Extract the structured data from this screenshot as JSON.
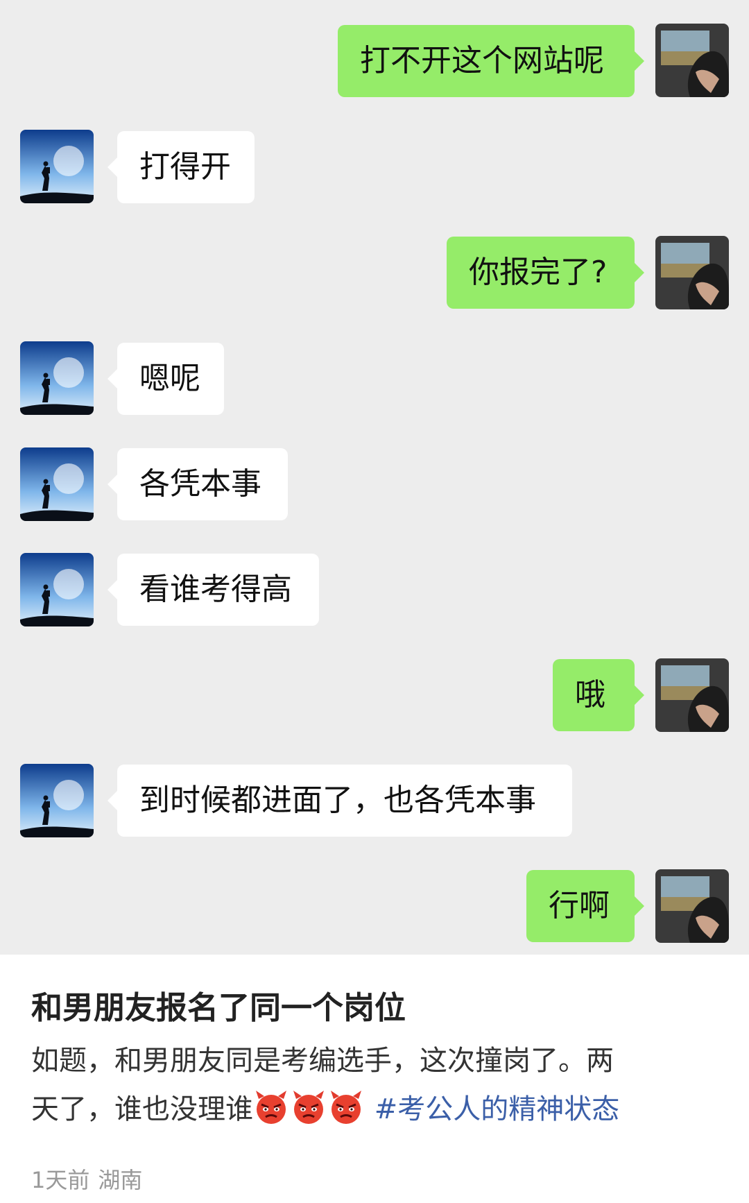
{
  "chat": {
    "messages": [
      {
        "side": "out",
        "text": "打不开这个网站呢"
      },
      {
        "side": "in",
        "text": "打得开"
      },
      {
        "side": "out",
        "text": "你报完了?"
      },
      {
        "side": "in",
        "text": "嗯呢"
      },
      {
        "side": "in",
        "text": "各凭本事"
      },
      {
        "side": "in",
        "text": "看谁考得高"
      },
      {
        "side": "out",
        "text": "哦"
      },
      {
        "side": "in",
        "text": "到时候都进面了，也各凭本事"
      },
      {
        "side": "out",
        "text": "行啊"
      }
    ],
    "colors": {
      "background": "#ededed",
      "incoming_bubble": "#ffffff",
      "outgoing_bubble": "#95ec69"
    },
    "avatars": {
      "incoming": "hiker-silhouette-avatar",
      "outgoing": "car-window-photo-avatar"
    }
  },
  "post": {
    "title": "和男朋友报名了同一个岗位",
    "body_line1": "如题，和男朋友同是考编选手，这次撞岗了。两",
    "body_line2_text": "天了，谁也没理谁",
    "emoji_icon": "angry-devil-emoji",
    "hashtag": "#考公人的精神状态",
    "time": "1天前",
    "location": "湖南"
  }
}
